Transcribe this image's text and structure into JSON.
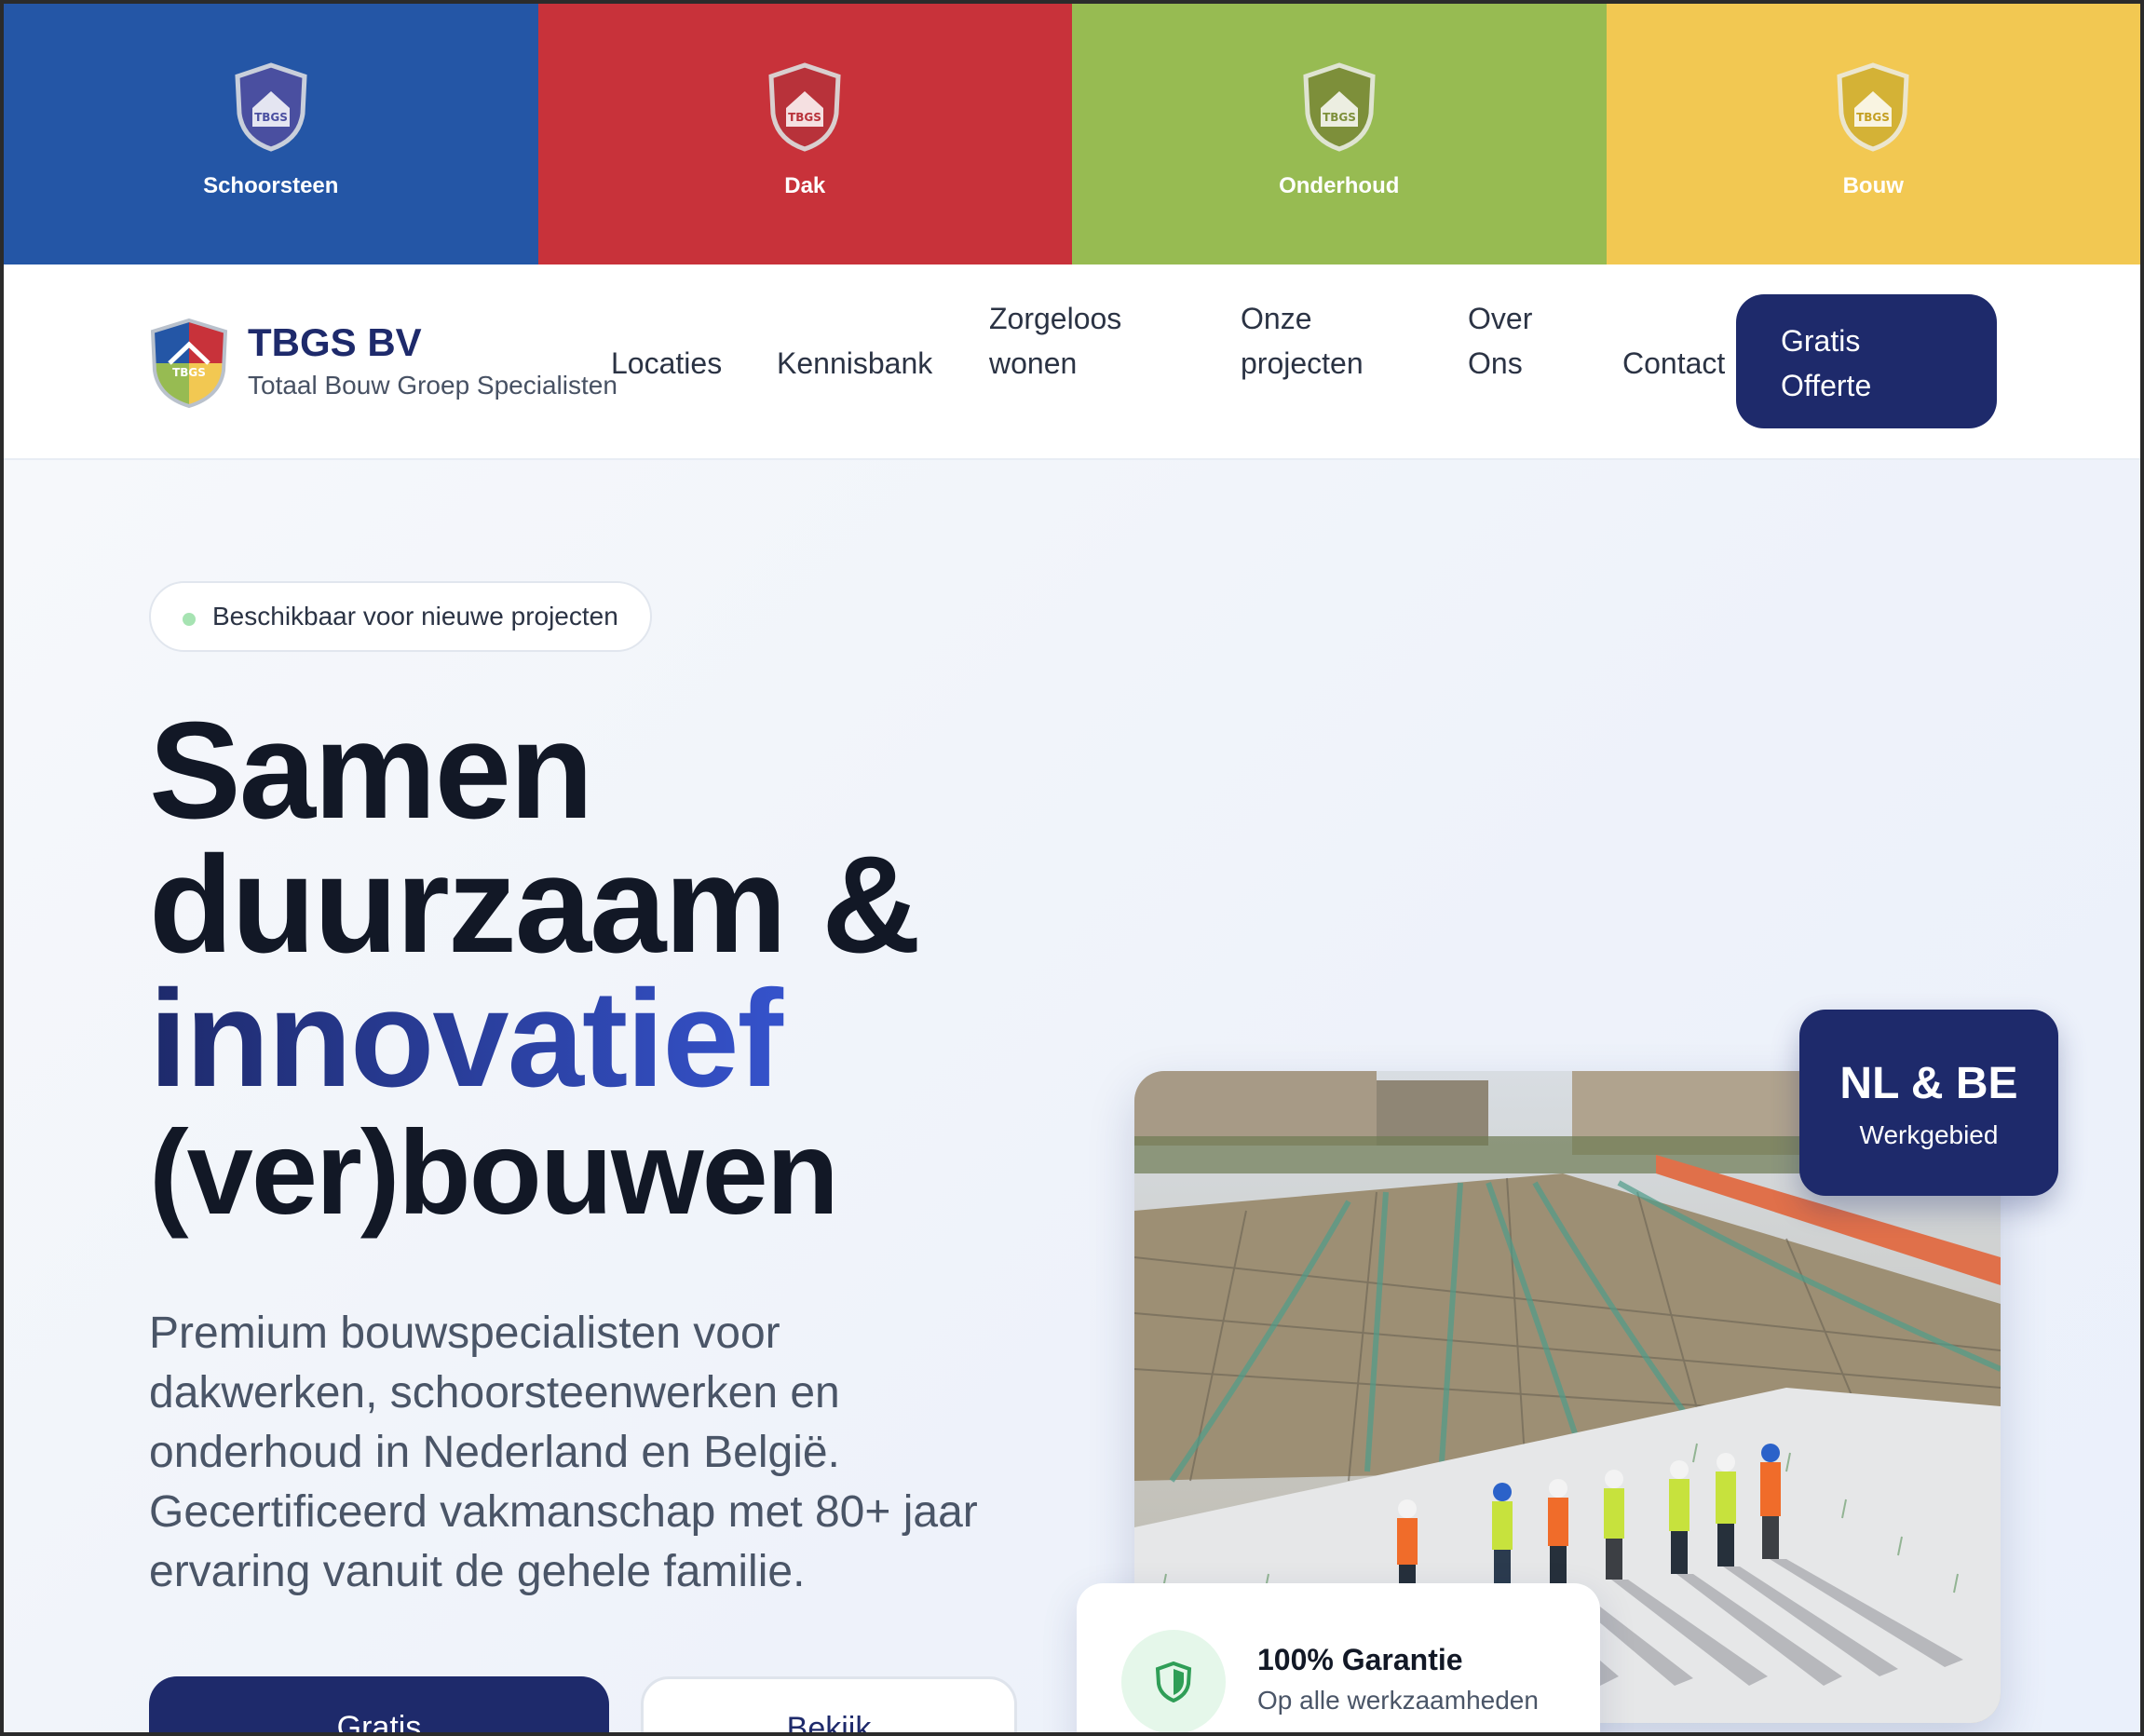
{
  "services": [
    {
      "label": "Schoorsteen",
      "color": "#2456a6",
      "icon": "shield-house-icon"
    },
    {
      "label": "Dak",
      "color": "#c8323a",
      "icon": "shield-house-icon"
    },
    {
      "label": "Onderhoud",
      "color": "#97bb52",
      "icon": "shield-house-icon"
    },
    {
      "label": "Bouw",
      "color": "#f2c852",
      "icon": "shield-house-icon"
    }
  ],
  "header": {
    "brand_name": "TBGS BV",
    "brand_tagline": "Totaal Bouw Groep Specialisten",
    "nav": {
      "locaties": "Locaties",
      "kennisbank": "Kennisbank",
      "zorgeloos_1": "Zorgeloos",
      "zorgeloos_2": "wonen",
      "projecten_1": "Onze",
      "projecten_2": "projecten",
      "over_1": "Over",
      "over_2": "Ons",
      "contact": "Contact"
    },
    "cta_line1": "Gratis",
    "cta_line2": "Offerte"
  },
  "hero": {
    "badge": "Beschikbaar voor nieuwe projecten",
    "headline_line1": "Samen",
    "headline_line2": "duurzaam &",
    "headline_accent": "innovatief",
    "headline_line4": "(ver)bouwen",
    "lead": "Premium bouwspecialisten voor dakwerken, schoorsteenwerken en onderhoud in Nederland en België. Gecertificeerd vakmanschap met 80+ jaar ervaring vanuit de gehele familie.",
    "primary_button": "Gratis",
    "secondary_button": "Bekijk"
  },
  "region_card": {
    "big": "NL & BE",
    "small": "Werkgebied"
  },
  "guarantee_card": {
    "title": "100% Garantie",
    "subtitle": "Op alle werkzaamheden",
    "icon": "shield-icon"
  },
  "colors": {
    "navy": "#1e2a6b",
    "accent_blue": "#3a5be0",
    "status_green": "#a6e3b2"
  }
}
